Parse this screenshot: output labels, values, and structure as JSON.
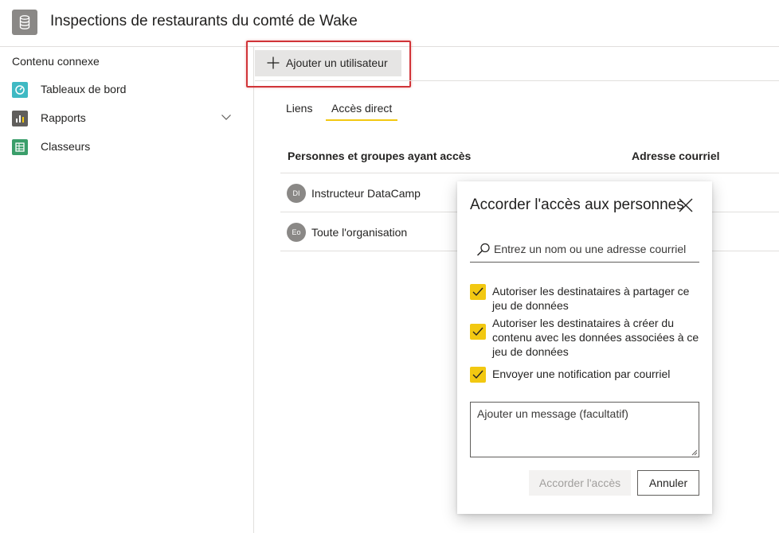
{
  "header": {
    "title": "Inspections de restaurants du comté de Wake",
    "icon": "database-icon"
  },
  "sidebar": {
    "title": "Contenu connexe",
    "items": [
      {
        "label": "Tableaux de bord",
        "icon": "dashboard-icon",
        "color": "#3fb9c3"
      },
      {
        "label": "Rapports",
        "icon": "report-icon",
        "color": "#605e5c",
        "expandable": true
      },
      {
        "label": "Classeurs",
        "icon": "workbook-icon",
        "color": "#3a9e6a"
      }
    ]
  },
  "toolbar": {
    "add_user_label": "Ajouter un utilisateur"
  },
  "tabs": [
    {
      "label": "Liens",
      "active": false
    },
    {
      "label": "Accès direct",
      "active": true
    }
  ],
  "access_table": {
    "columns": [
      "Personnes et groupes ayant accès",
      "Adresse courriel"
    ],
    "rows": [
      {
        "initials": "DI",
        "name": "Instructeur DataCamp"
      },
      {
        "initials": "Eo",
        "name": "Toute l'organisation"
      }
    ]
  },
  "dialog": {
    "title": "Accorder l'accès aux personnes",
    "search_placeholder": "Entrez un nom ou une adresse courriel",
    "options": [
      {
        "label": "Autoriser les destinataires à partager ce jeu de données",
        "checked": true
      },
      {
        "label": "Autoriser les destinataires à créer du contenu avec les données associées à ce jeu de données",
        "checked": true
      },
      {
        "label": "Envoyer une notification par courriel",
        "checked": true
      }
    ],
    "message_placeholder": "Ajouter un message (facultatif)",
    "grant_label": "Accorder l'accès",
    "cancel_label": "Annuler"
  },
  "colors": {
    "accent": "#f2c811",
    "highlight": "#d13438"
  }
}
